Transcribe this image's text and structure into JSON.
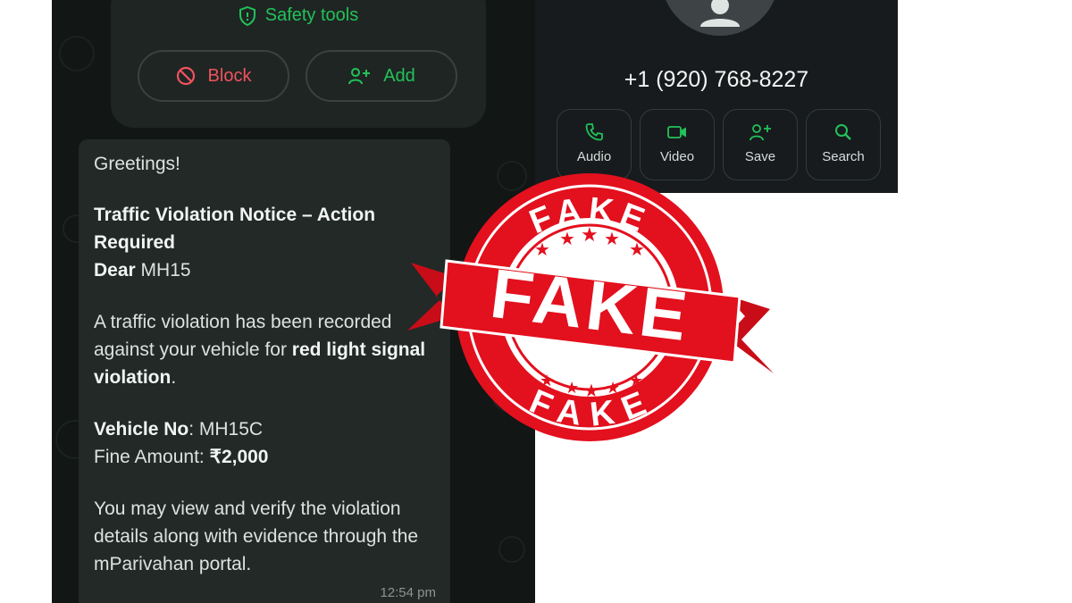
{
  "chat": {
    "safety_tools_label": "Safety tools",
    "block_label": "Block",
    "add_label": "Add",
    "message": {
      "greeting": "Greetings!",
      "notice_title": "Traffic Violation Notice – Action Required",
      "dear_label": "Dear",
      "dear_value": "MH15",
      "body_line1": "A traffic violation has been recorded against your vehicle for",
      "violation_type": "red light signal violation",
      "body_line1_end": ".",
      "vehicle_label": "Vehicle No",
      "vehicle_value": "MH15C",
      "fine_label": "Fine Amount:",
      "fine_value": "₹2,000",
      "closing_text": "You may view and verify the violation details along with evidence through the mParivahan portal.",
      "time": "12:54 pm"
    }
  },
  "contact": {
    "phone_number": "+1 (920) 768-8227",
    "actions": [
      {
        "label": "Audio",
        "icon": "phone-icon"
      },
      {
        "label": "Video",
        "icon": "video-icon"
      },
      {
        "label": "Save",
        "icon": "add-person-icon"
      },
      {
        "label": "Search",
        "icon": "search-icon"
      }
    ]
  },
  "stamp": {
    "top_text": "FAKE",
    "center_text": "FAKE",
    "bottom_text": "FAKE",
    "color": "#e3101e"
  },
  "colors": {
    "accent_green": "#22c25a",
    "block_red": "#f0525e",
    "chat_bg": "#121615",
    "bubble_bg": "#222927"
  }
}
